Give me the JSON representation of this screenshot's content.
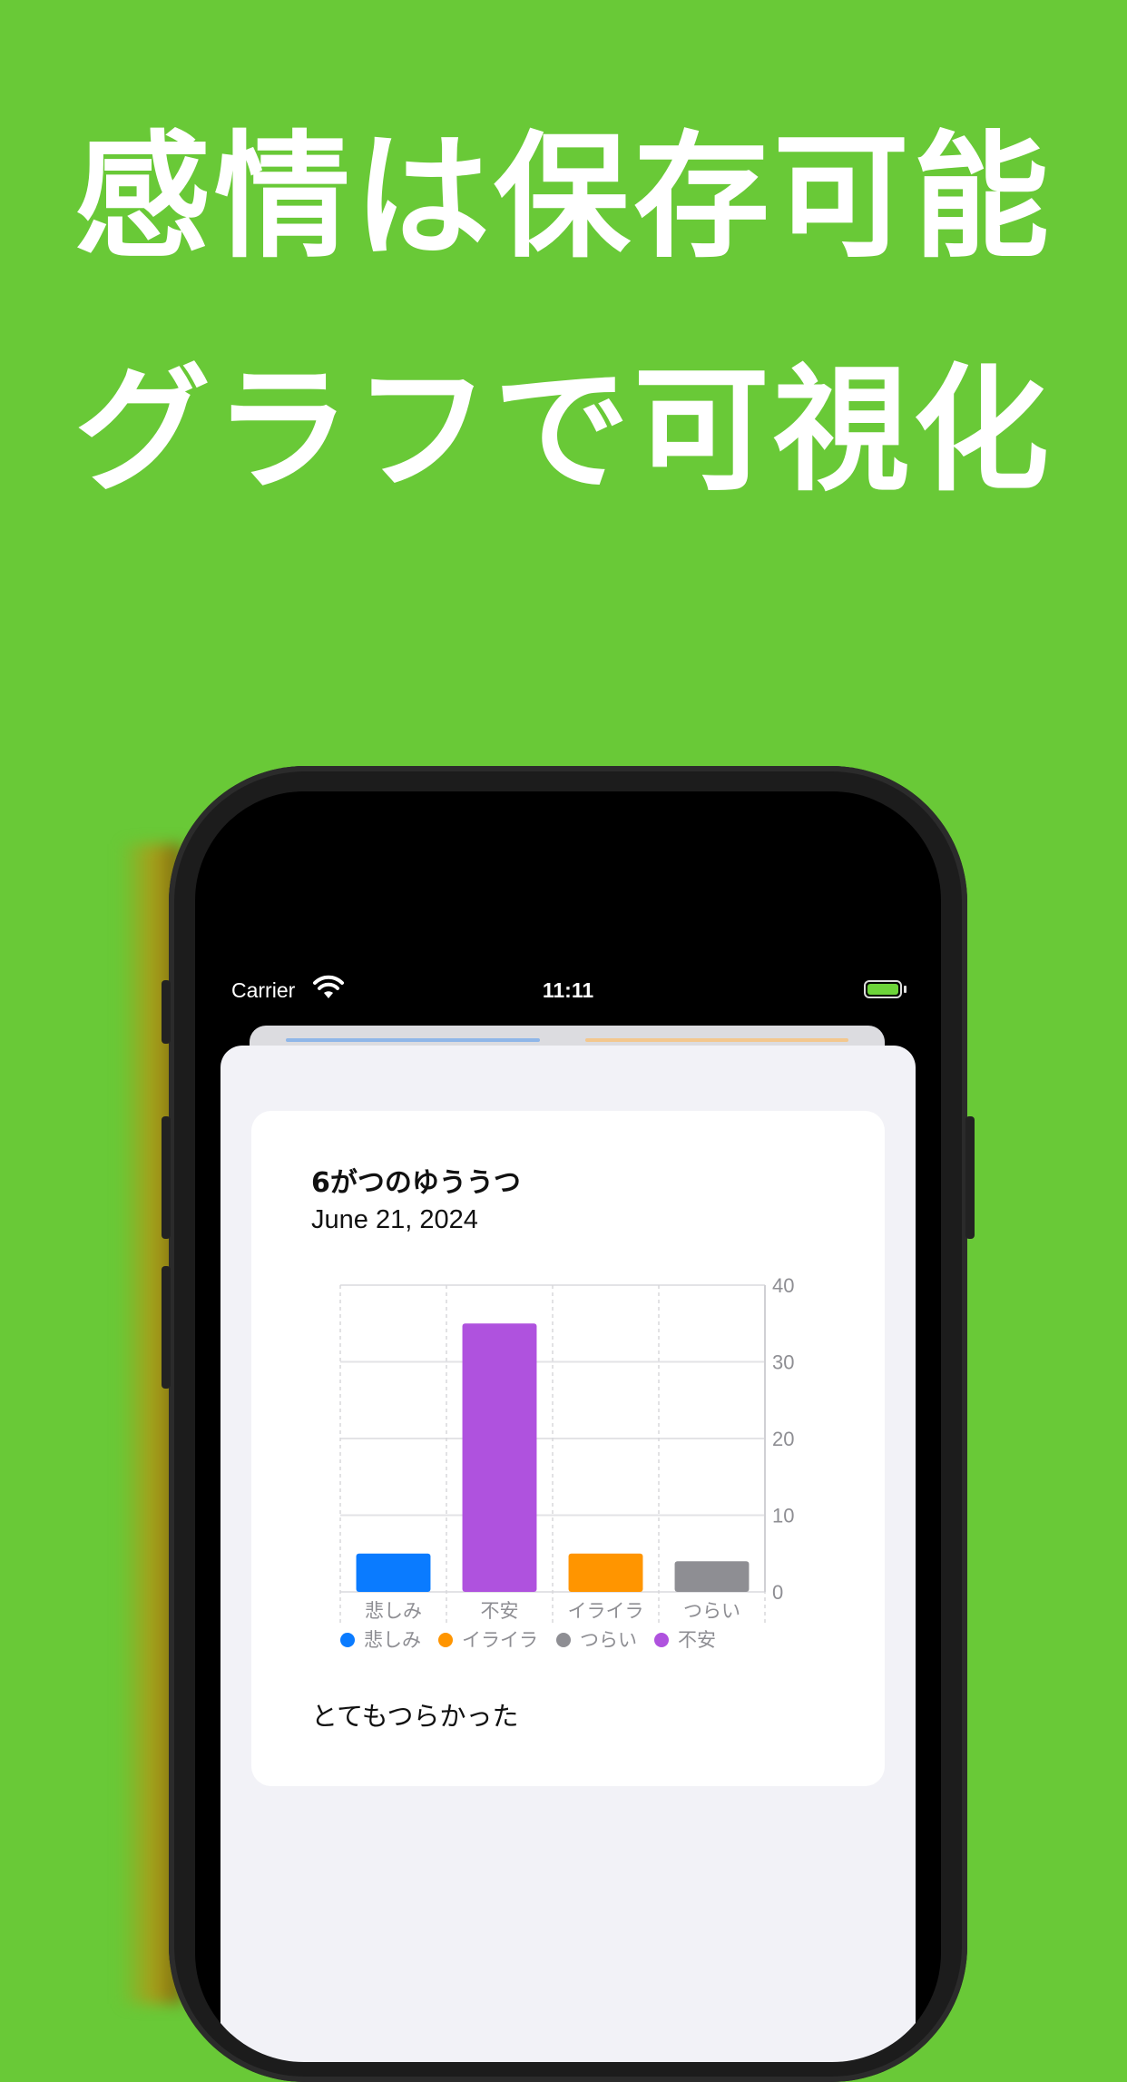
{
  "promo": {
    "headline_1": "感情は保存可能",
    "headline_2": "グラフで可視化",
    "background_color": "#69c937"
  },
  "status_bar": {
    "carrier": "Carrier",
    "time": "11:11",
    "wifi_icon": "wifi-icon",
    "battery_icon": "battery-icon"
  },
  "entry": {
    "title": "6がつのゆううつ",
    "date": "June 21, 2024",
    "note": "とてもつらかった"
  },
  "chart_data": {
    "type": "bar",
    "categories": [
      "悲しみ",
      "不安",
      "イライラ",
      "つらい"
    ],
    "values": [
      5,
      35,
      5,
      4
    ],
    "colors": [
      "#0a7bff",
      "#af52de",
      "#ff9500",
      "#8e8e93"
    ],
    "ylim": [
      0,
      40
    ],
    "yticks": [
      "0",
      "10",
      "20",
      "30",
      "40"
    ],
    "y_axis_side": "right",
    "grid": true,
    "legend_position": "bottom-left",
    "legend": [
      {
        "label": "悲しみ",
        "color": "#0a7bff"
      },
      {
        "label": "イライラ",
        "color": "#ff9500"
      },
      {
        "label": "つらい",
        "color": "#8e8e93"
      },
      {
        "label": "不安",
        "color": "#af52de"
      }
    ]
  }
}
